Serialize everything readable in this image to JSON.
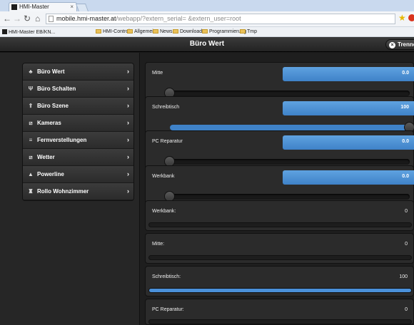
{
  "browser": {
    "tab_title": "HMI-Master",
    "tab_close": "×",
    "url_main": "mobile.hmi-master.at",
    "url_rest": "/webapp/?extern_serial=            &extern_user=root",
    "bookmarks": [
      "HMI-Master EB/KN...",
      "HMI-Control",
      "Allgemein",
      "News",
      "Download",
      "Programmierung",
      "Tmp"
    ]
  },
  "header": {
    "title": "Büro Wert",
    "trennen_label": "Trenne",
    "trennen_icon": "×"
  },
  "sidebar": {
    "items": [
      {
        "label": "Büro Wert",
        "icon": "♣"
      },
      {
        "label": "Büro Schalten",
        "icon": "Ψ"
      },
      {
        "label": "Büro Szene",
        "icon": "⇑"
      },
      {
        "label": "Kameras",
        "icon": "⧄"
      },
      {
        "label": "Fernverstellungen",
        "icon": "≡"
      },
      {
        "label": "Wetter",
        "icon": "⧄"
      },
      {
        "label": "Powerline",
        "icon": "▲"
      },
      {
        "label": "Rollo Wohnzimmer",
        "icon": "♜"
      }
    ],
    "chevron": "›"
  },
  "sliders": [
    {
      "label": "Mitte",
      "value": "0.0",
      "level": 0.0
    },
    {
      "label": "Schreibtisch",
      "value": "100",
      "level": 1.0
    },
    {
      "label": "PC Reparatur",
      "value": "0.0",
      "level": 0.0
    },
    {
      "label": "Werkbank",
      "value": "0.0",
      "level": 0.0
    }
  ],
  "readouts": [
    {
      "label": "Werkbank:",
      "value": "0",
      "level": 0.0
    },
    {
      "label": "Mitte:",
      "value": "0",
      "level": 0.0
    },
    {
      "label": "Schreibtisch:",
      "value": "100",
      "level": 1.0
    },
    {
      "label": "PC Reparatur:",
      "value": "0",
      "level": 0.0
    }
  ],
  "colors": {
    "accent": "#4a90d9",
    "header_bg": "#2b2b2b"
  }
}
